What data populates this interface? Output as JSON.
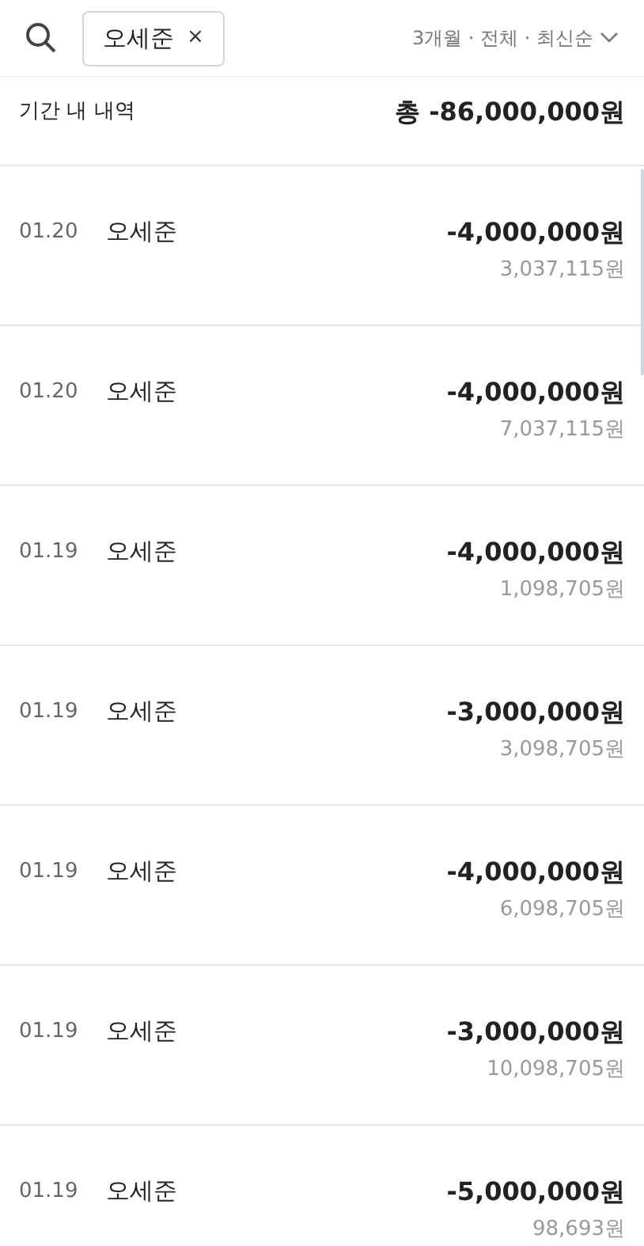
{
  "filter_chip": {
    "label": "오세준",
    "remove": "×"
  },
  "filter_summary": "3개월 · 전체 · 최신순",
  "summary": {
    "label": "기간 내 내역",
    "total": "총 -86,000,000원"
  },
  "transactions": [
    {
      "date": "01.20",
      "name": "오세준",
      "amount": "-4,000,000원",
      "balance": "3,037,115원"
    },
    {
      "date": "01.20",
      "name": "오세준",
      "amount": "-4,000,000원",
      "balance": "7,037,115원"
    },
    {
      "date": "01.19",
      "name": "오세준",
      "amount": "-4,000,000원",
      "balance": "1,098,705원"
    },
    {
      "date": "01.19",
      "name": "오세준",
      "amount": "-3,000,000원",
      "balance": "3,098,705원"
    },
    {
      "date": "01.19",
      "name": "오세준",
      "amount": "-4,000,000원",
      "balance": "6,098,705원"
    },
    {
      "date": "01.19",
      "name": "오세준",
      "amount": "-3,000,000원",
      "balance": "10,098,705원"
    },
    {
      "date": "01.19",
      "name": "오세준",
      "amount": "-5,000,000원",
      "balance": "98,693원"
    }
  ]
}
